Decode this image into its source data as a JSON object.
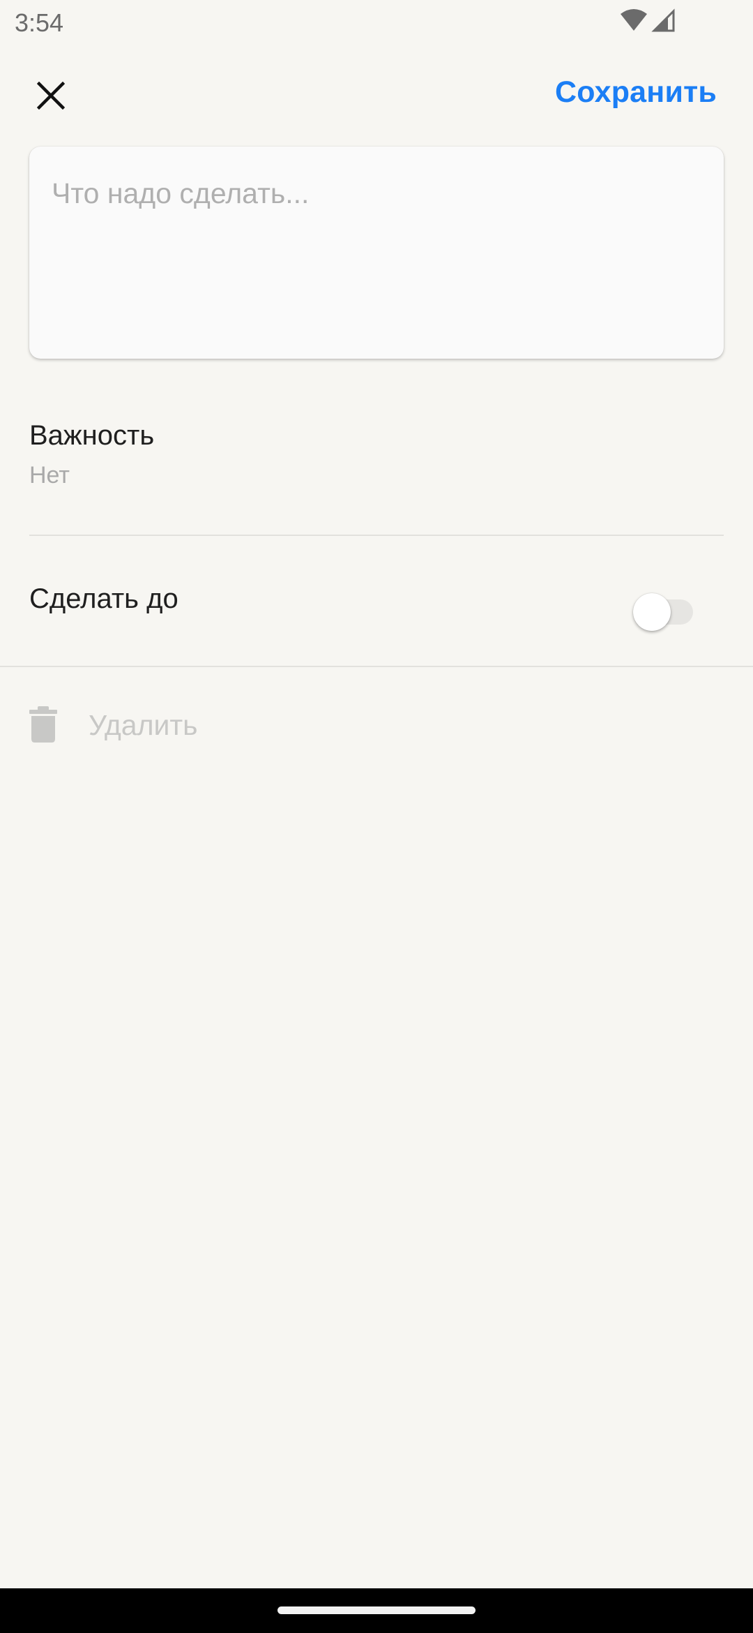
{
  "status_bar": {
    "time": "3:54",
    "icons": [
      "wifi-icon",
      "cellular-signal-icon"
    ]
  },
  "toolbar": {
    "close_icon": "close-icon",
    "save_label": "Сохранить"
  },
  "task_input": {
    "value": "",
    "placeholder": "Что надо сделать..."
  },
  "importance": {
    "title": "Важность",
    "value": "Нет"
  },
  "deadline": {
    "title": "Сделать до",
    "enabled": false
  },
  "delete": {
    "icon": "trash-icon",
    "label": "Удалить"
  },
  "colors": {
    "accent": "#1B7EF5",
    "background": "#F7F6F2",
    "card": "#FAFAFA",
    "disabled": "#C8C8C6"
  }
}
